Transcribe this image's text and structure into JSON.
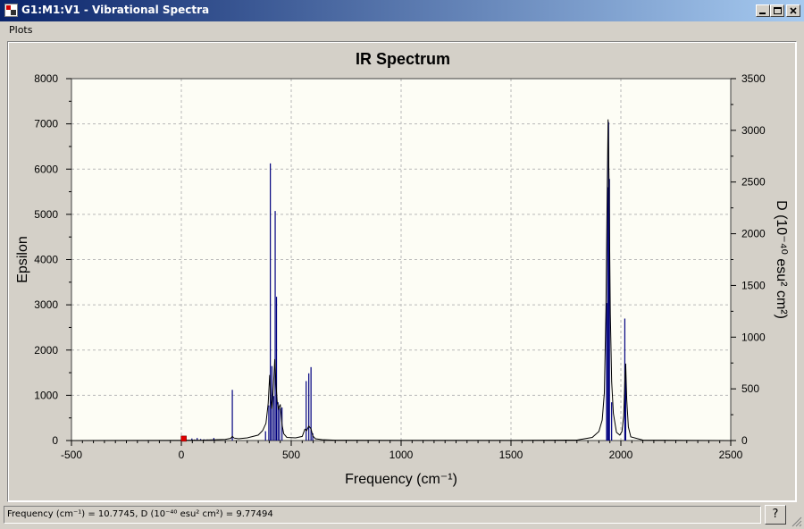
{
  "window": {
    "title": "G1:M1:V1 - Vibrational Spectra",
    "controls": {
      "minimize": "_",
      "maximize": "□",
      "close": "✕"
    }
  },
  "menu": {
    "items": [
      "Plots"
    ]
  },
  "status": {
    "text": "Frequency (cm⁻¹) = 10.7745, D (10⁻⁴⁰ esu² cm²) = 9.77494",
    "help_icon": "help-question-icon"
  },
  "chart_data": {
    "type": "line",
    "title": "IR Spectrum",
    "xlabel": "Frequency (cm⁻¹)",
    "ylabel": "Epsilon",
    "y2label": "D (10⁻⁴⁰ esu² cm²)",
    "xlim": [
      -500,
      2500
    ],
    "ylim": [
      0,
      8000
    ],
    "y2lim": [
      0,
      3500
    ],
    "xticks": [
      -500,
      0,
      500,
      1000,
      1500,
      2000,
      2500
    ],
    "yticks": [
      0,
      1000,
      2000,
      3000,
      4000,
      5000,
      6000,
      7000,
      8000
    ],
    "y2ticks": [
      0,
      500,
      1000,
      1500,
      2000,
      2500,
      3000,
      3500
    ],
    "grid": true,
    "colors": {
      "stick": "#00007f",
      "curve": "#000000",
      "marker": "#e00000",
      "plot_bg": "#fdfdf5"
    },
    "series": [
      {
        "name": "D",
        "axis": "right",
        "style": "sticks",
        "x": [
          48,
          60,
          72,
          88,
          102,
          118,
          135,
          148,
          232,
          383,
          398,
          405,
          412,
          420,
          427,
          433,
          440,
          447,
          458,
          568,
          580,
          590,
          598,
          1935,
          1940,
          1944,
          1948,
          1958,
          2018,
          2022
        ],
        "values": [
          20,
          10,
          25,
          15,
          12,
          10,
          8,
          25,
          490,
          90,
          340,
          2680,
          720,
          430,
          2220,
          1390,
          370,
          310,
          320,
          575,
          650,
          710,
          70,
          1330,
          2450,
          3080,
          2530,
          370,
          1180,
          730
        ]
      },
      {
        "name": "Epsilon",
        "axis": "left",
        "style": "curve",
        "x": [
          -500,
          0,
          100,
          200,
          225,
          232,
          240,
          260,
          300,
          350,
          370,
          385,
          395,
          402,
          407,
          412,
          418,
          425,
          430,
          436,
          442,
          450,
          458,
          466,
          480,
          520,
          550,
          562,
          570,
          580,
          590,
          598,
          610,
          640,
          700,
          1000,
          1500,
          1800,
          1870,
          1900,
          1915,
          1925,
          1932,
          1938,
          1942,
          1946,
          1952,
          1958,
          1966,
          1980,
          1995,
          2005,
          2013,
          2018,
          2022,
          2027,
          2034,
          2045,
          2100,
          2500
        ],
        "values": [
          0,
          5,
          10,
          25,
          50,
          90,
          55,
          40,
          60,
          120,
          220,
          380,
          820,
          1450,
          900,
          700,
          1100,
          1800,
          1300,
          850,
          700,
          800,
          350,
          150,
          70,
          60,
          90,
          250,
          220,
          320,
          260,
          100,
          40,
          20,
          8,
          5,
          5,
          10,
          70,
          200,
          450,
          1050,
          2900,
          5500,
          7100,
          5800,
          2800,
          1300,
          600,
          180,
          120,
          200,
          550,
          1280,
          1700,
          900,
          300,
          80,
          10,
          0
        ]
      }
    ],
    "marker": {
      "x": 10.7745,
      "value": 9.77494
    }
  }
}
